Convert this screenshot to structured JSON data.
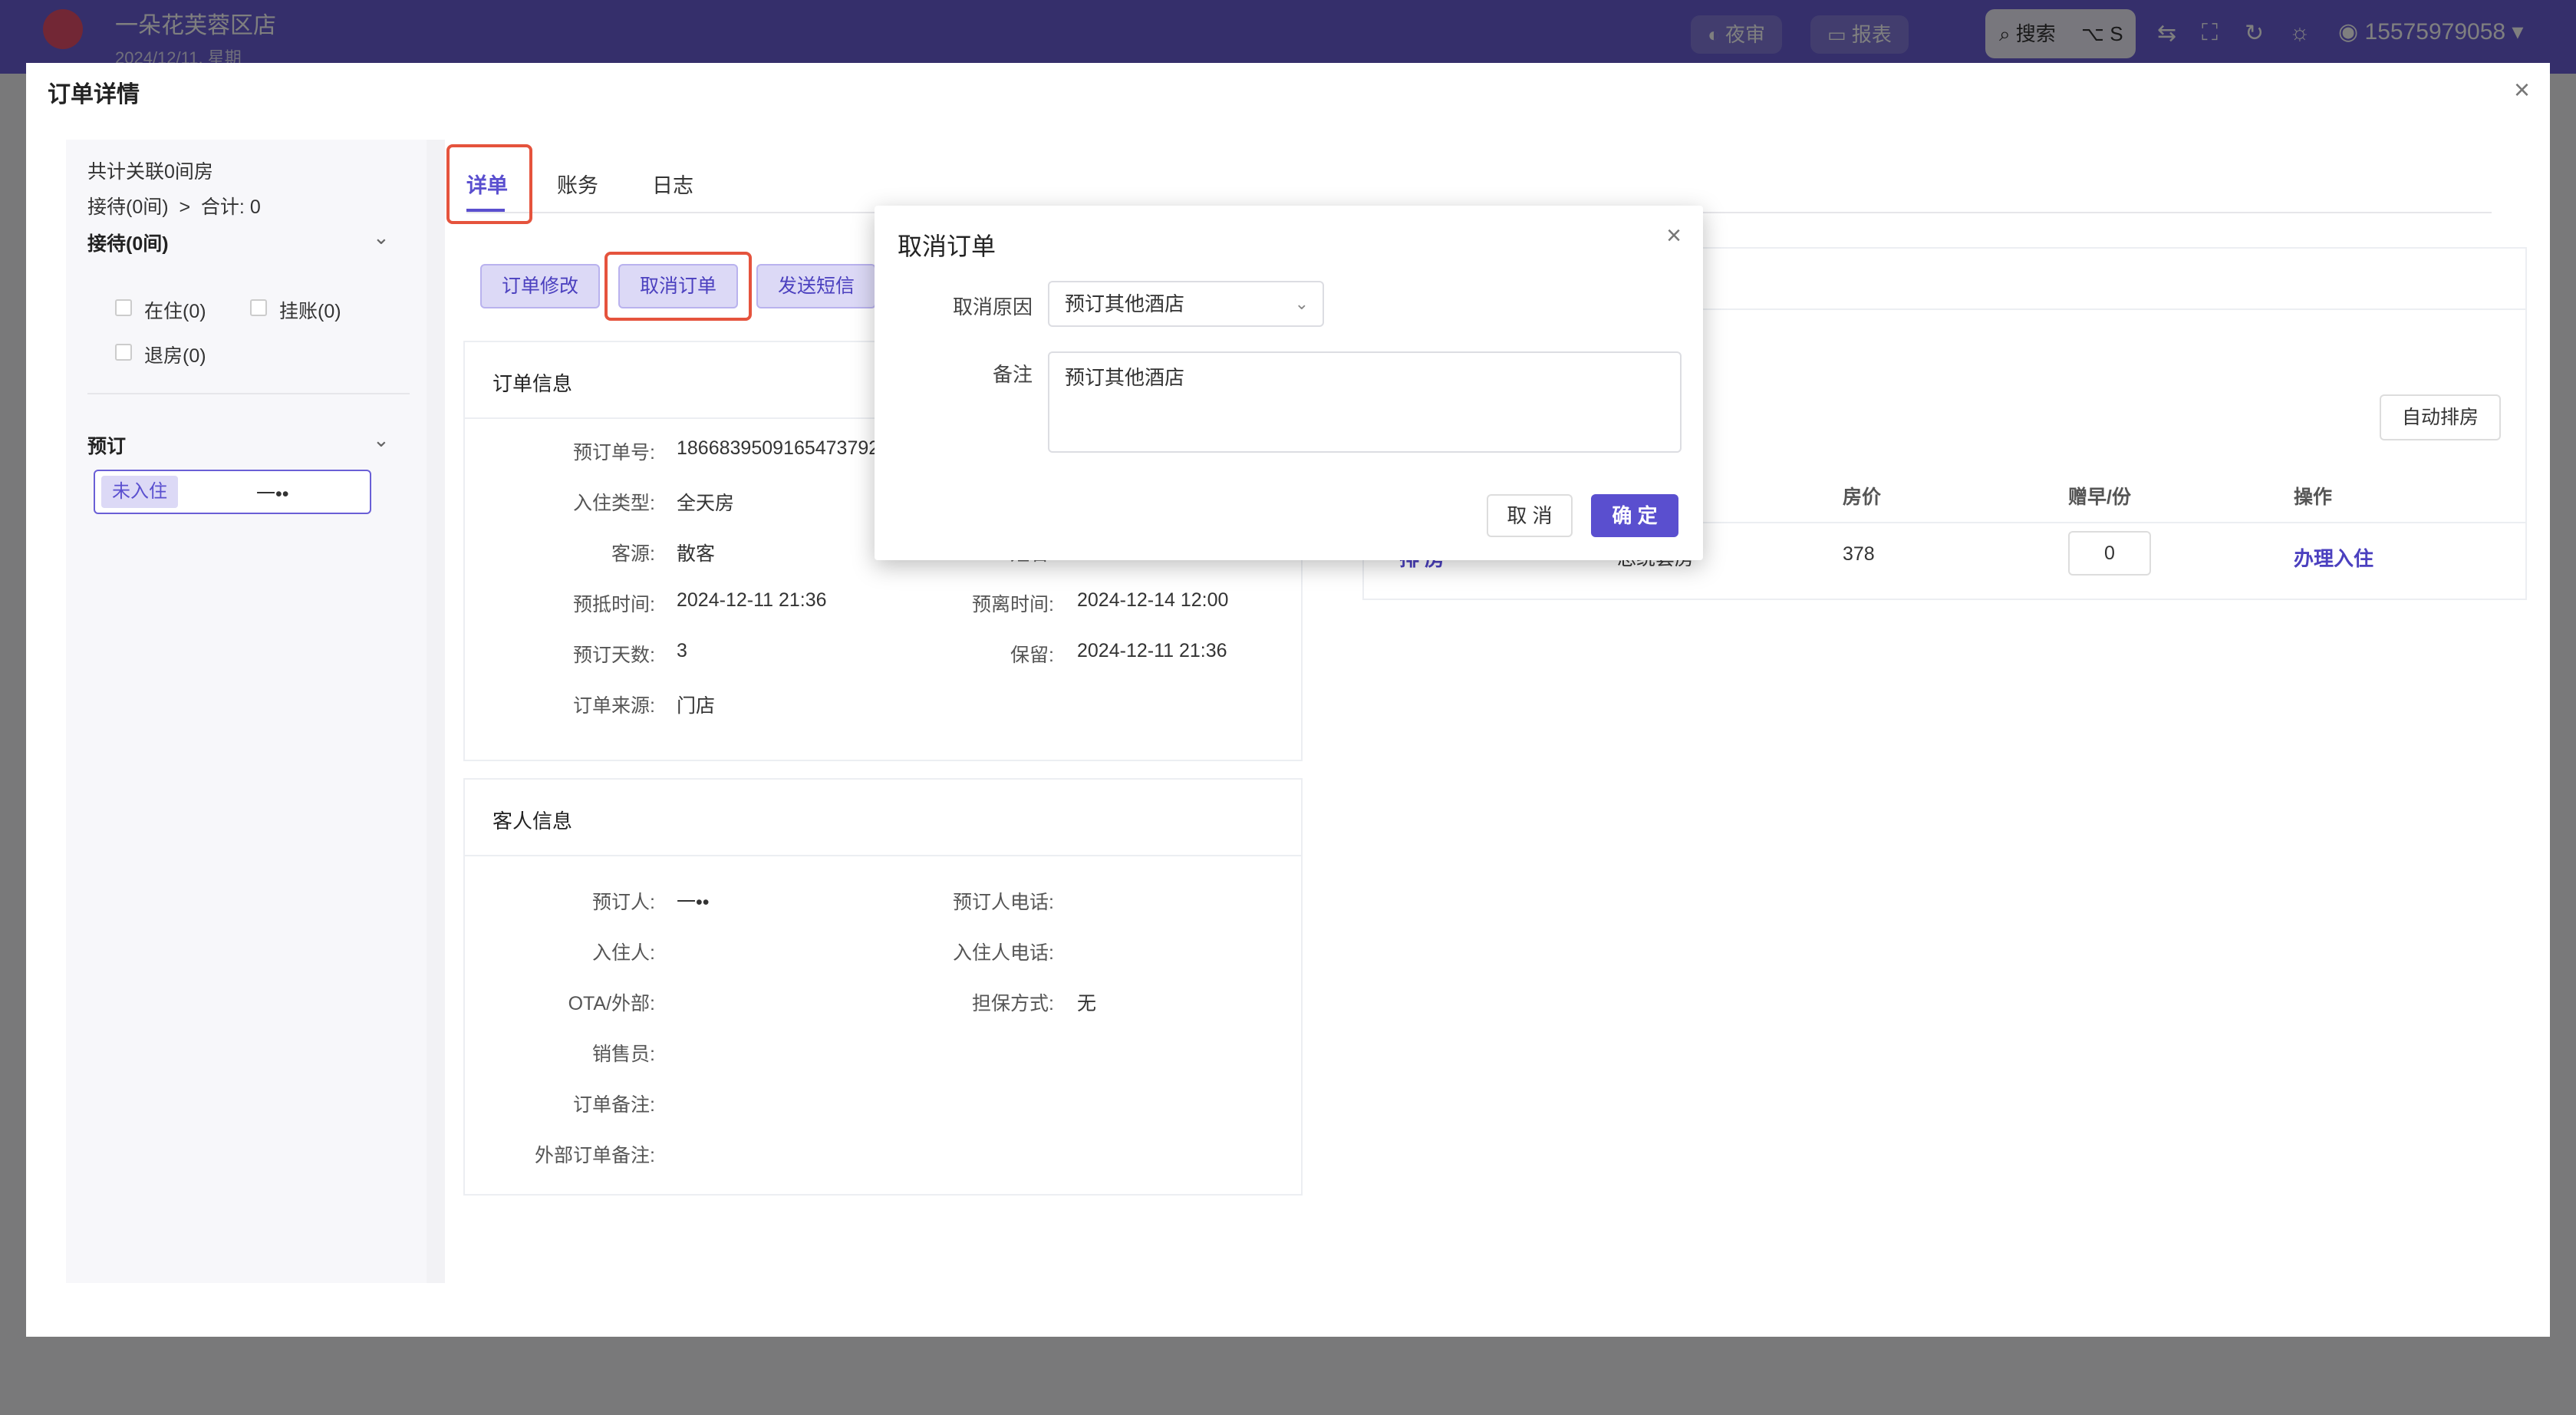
{
  "topbar": {
    "store_name": "一朵花芙蓉区店",
    "store_date": "2024/12/11, 星期",
    "night_audit": "夜审",
    "report": "报表",
    "search": "搜索",
    "search_shortcut": "⌥ S",
    "user_phone": "15575979058"
  },
  "drawer": {
    "title": "订单详情",
    "sidebar": {
      "summary": "共计关联0间房",
      "summary_breakdown": "接待(0间)  >  合计: 0",
      "reception_section": "接待(0间)",
      "checkboxes": [
        "在住(0)",
        "挂账(0)",
        "退房(0)"
      ],
      "booking_section": "预订",
      "guest_tag": "未入住",
      "guest_name": "一••"
    },
    "tabs": [
      "详单",
      "账务",
      "日志"
    ],
    "actions": {
      "modify": "订单修改",
      "cancel": "取消订单",
      "sms": "发送短信"
    },
    "order_info": {
      "title": "订单信息",
      "fields": {
        "order_no_label": "预订单号:",
        "order_no": "1866839509165473792",
        "stay_type_label": "入住类型:",
        "stay_type": "全天房",
        "source_label": "客源:",
        "source": "散客",
        "name_label": "姓名:",
        "arrival_label": "预抵时间:",
        "arrival": "2024-12-11 21:36",
        "departure_label": "预离时间:",
        "departure": "2024-12-14 12:00",
        "days_label": "预订天数:",
        "days": "3",
        "hold_label": "保留:",
        "hold": "2024-12-11 21:36",
        "channel_label": "订单来源:",
        "channel": "门店"
      }
    },
    "guest_info": {
      "title": "客人信息",
      "booker_label": "预订人:",
      "booker": "一••",
      "booker_phone_label": "预订人电话:",
      "occupant_label": "入住人:",
      "occupant_phone_label": "入住人电话:",
      "ota_label": "OTA/外部:",
      "guarantee_label": "担保方式:",
      "guarantee": "无",
      "sales_label": "销售员:",
      "remark_label": "订单备注:",
      "ext_remark_label": "外部订单备注:"
    },
    "rooms": {
      "auto_assign": "自动排房",
      "headers": {
        "price": "房价",
        "breakfast": "赠早/份",
        "op": "操作"
      },
      "row": {
        "assign": "排 房",
        "room_type": "总统套房",
        "price": "378",
        "breakfast": "0",
        "checkin": "办理入住"
      }
    }
  },
  "dialog": {
    "title": "取消订单",
    "reason_label": "取消原因",
    "reason_value": "预订其他酒店",
    "remark_label": "备注",
    "remark_value": "预订其他酒店",
    "cancel": "取 消",
    "ok": "确 定"
  },
  "colors": {
    "accent": "#5a4fcf",
    "highlight": "#e5533d",
    "topbar": "#6a5fd6"
  },
  "icons": [
    "close-icon",
    "chevron-down-icon",
    "search-icon",
    "moon-icon",
    "report-icon",
    "translate-icon",
    "fullscreen-icon",
    "refresh-icon",
    "sun-icon",
    "user-icon"
  ]
}
